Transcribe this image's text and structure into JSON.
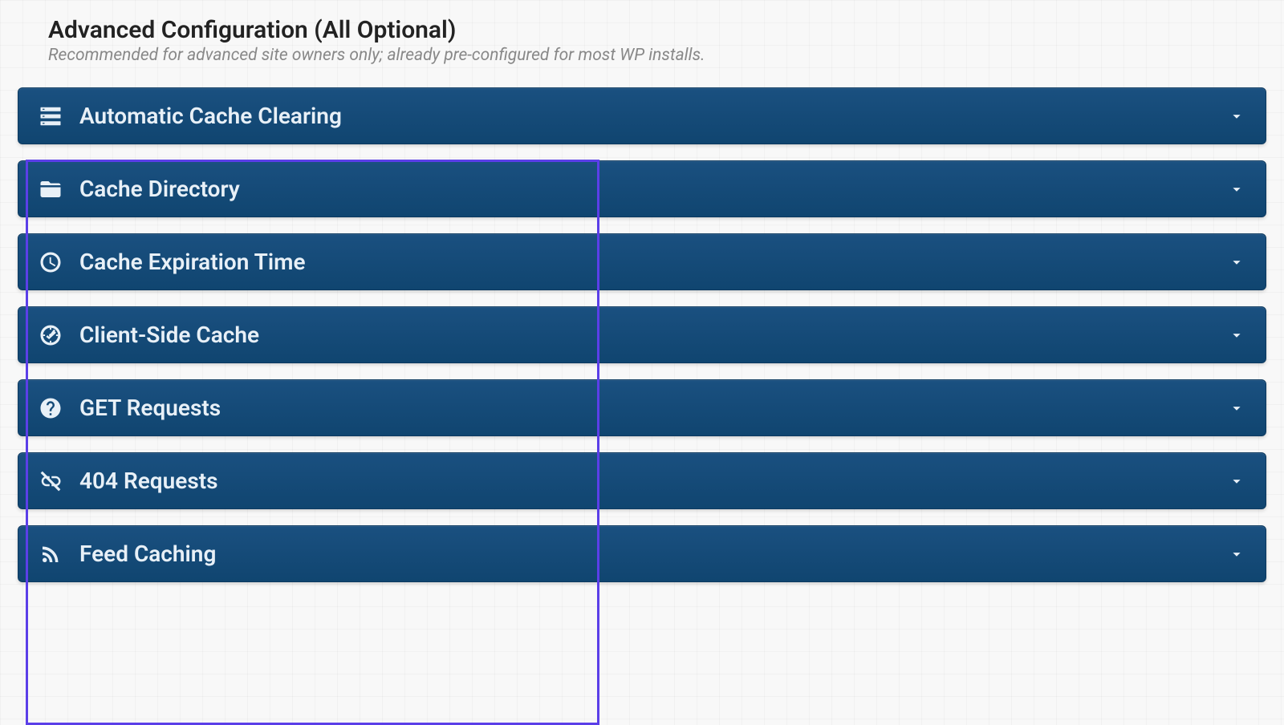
{
  "header": {
    "title": "Advanced Configuration (All Optional)",
    "subtitle": "Recommended for advanced site owners only; already pre-configured for most WP installs."
  },
  "accordion": {
    "items": [
      {
        "icon": "server-icon",
        "label": "Automatic Cache Clearing"
      },
      {
        "icon": "folder-icon",
        "label": "Cache Directory"
      },
      {
        "icon": "clock-icon",
        "label": "Cache Expiration Time"
      },
      {
        "icon": "gauge-icon",
        "label": "Client-Side Cache"
      },
      {
        "icon": "question-icon",
        "label": "GET Requests"
      },
      {
        "icon": "broken-link-icon",
        "label": "404 Requests"
      },
      {
        "icon": "rss-icon",
        "label": "Feed Caching"
      }
    ]
  },
  "colors": {
    "accent": "#104570",
    "highlight": "#5b3fe8"
  }
}
